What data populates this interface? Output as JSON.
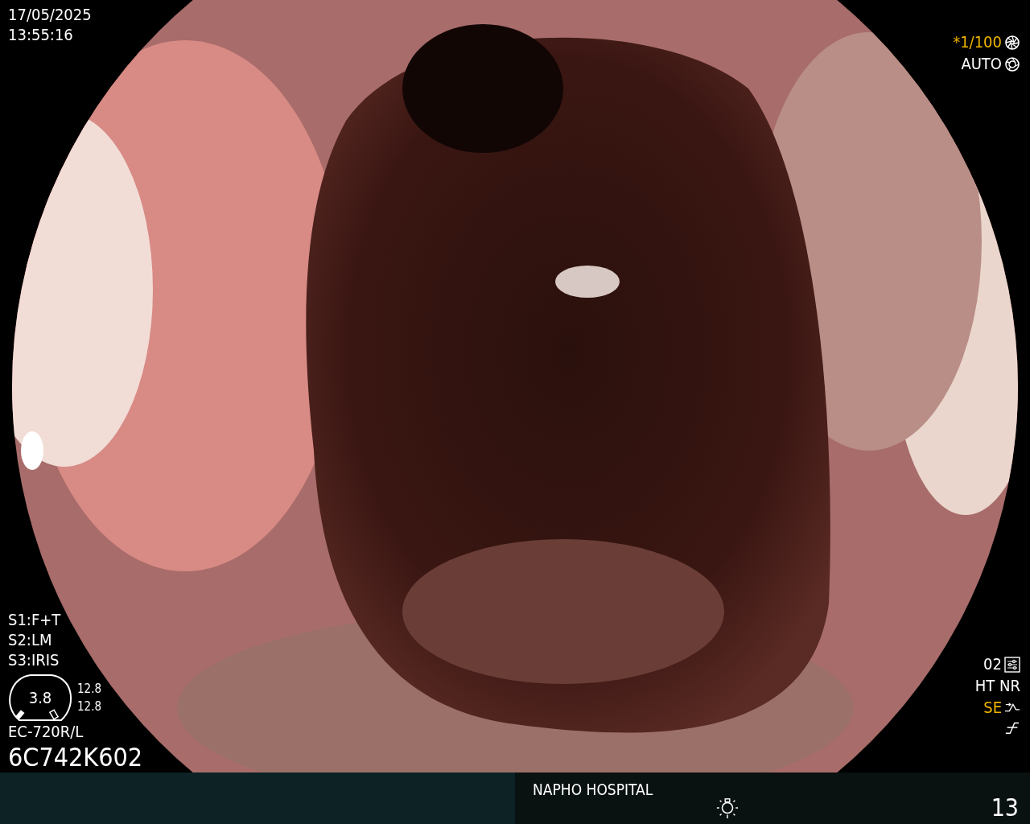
{
  "date": "17/05/2025",
  "time": "13:55:16",
  "shutter": "*1/100",
  "iris_mode": "AUTO",
  "switches": [
    "S1:F+T",
    "S2:LM",
    "S3:IRIS"
  ],
  "scope_gauge": {
    "value": "3.8",
    "readings": [
      "12.8",
      "12.8"
    ]
  },
  "scope_model": "EC-720R/L",
  "serial": "6C742K602",
  "settings": {
    "preset": "02",
    "noise": "HT NR",
    "enhance": "SE"
  },
  "footer": {
    "hospital": "NAPHO HOSPITAL",
    "counter": "13"
  }
}
